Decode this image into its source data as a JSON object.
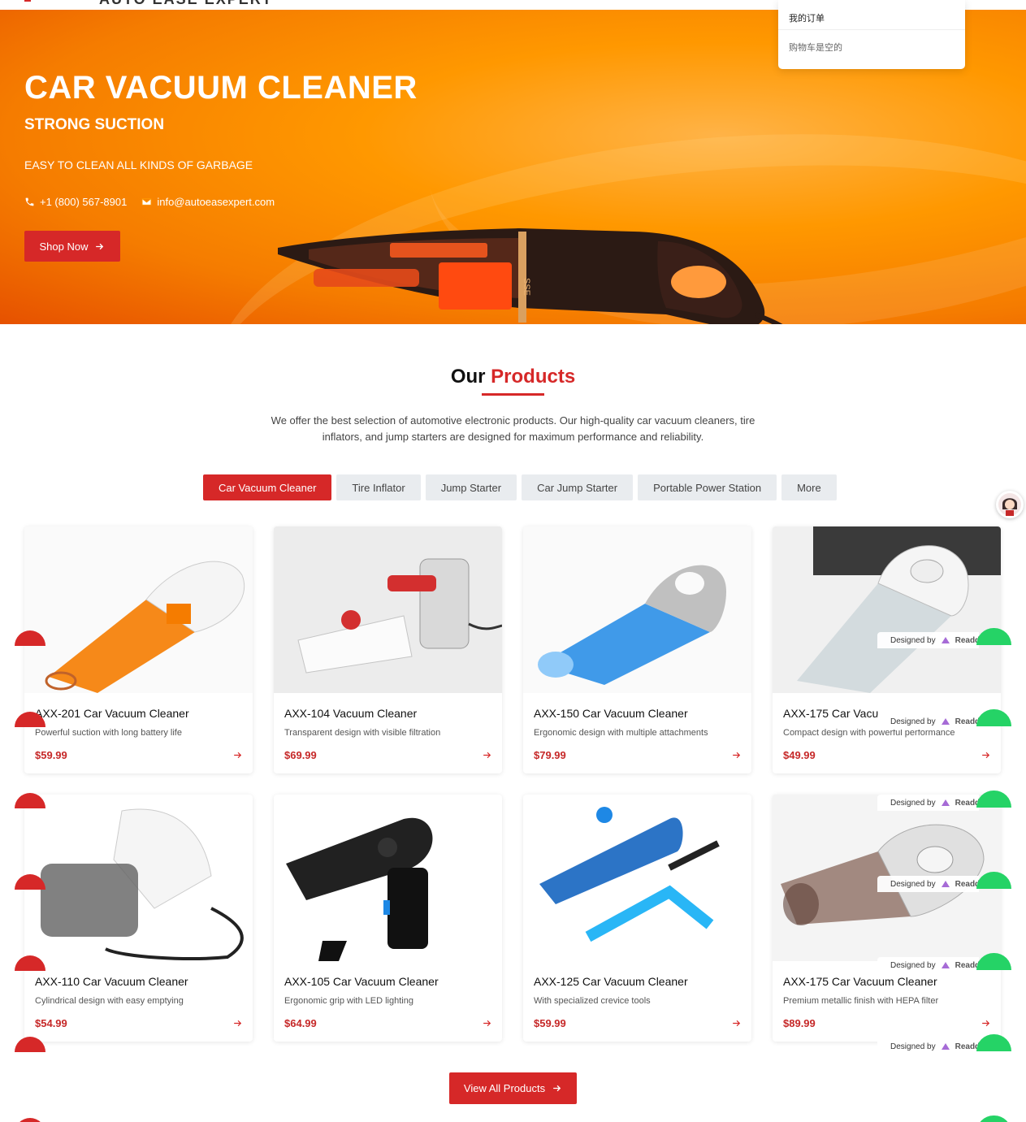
{
  "header": {
    "logo_text": "AUTO EASE EXPERT"
  },
  "cart": {
    "title": "我的订单",
    "empty_text": "购物车是空的"
  },
  "hero": {
    "title": "CAR VACUUM CLEANER",
    "subtitle": "STRONG SUCTION",
    "description": "EASY TO CLEAN ALL KINDS OF GARBAGE",
    "phone": "+1 (800) 567-8901",
    "email": "info@autoeasexpert.com",
    "cta_label": "Shop Now",
    "product_label": "SSE"
  },
  "products_section": {
    "title_part1": "Our",
    "title_part2": "Products",
    "description": "We offer the best selection of automotive electronic products. Our high-quality car vacuum cleaners, tire inflators, and jump starters are designed for maximum performance and reliability.",
    "tabs": [
      {
        "label": "Car Vacuum Cleaner",
        "active": true
      },
      {
        "label": "Tire Inflator",
        "active": false
      },
      {
        "label": "Jump Starter",
        "active": false
      },
      {
        "label": "Car Jump Starter",
        "active": false
      },
      {
        "label": "Portable Power Station",
        "active": false
      },
      {
        "label": "More",
        "active": false
      }
    ],
    "products": [
      {
        "name": "AXX-201 Car Vacuum Cleaner",
        "desc": "Powerful suction with long battery life",
        "price": "$59.99",
        "color": "#f57c00"
      },
      {
        "name": "AXX-104 Vacuum Cleaner",
        "desc": "Transparent design with visible filtration",
        "price": "$69.99",
        "color": "#d32f2f"
      },
      {
        "name": "AXX-150 Car Vacuum Cleaner",
        "desc": "Ergonomic design with multiple attachments",
        "price": "$79.99",
        "color": "#1e88e5"
      },
      {
        "name": "AXX-175 Car Vacu",
        "desc": "Compact design with powerful performance",
        "price": "$49.99",
        "color": "#bdbdbd"
      },
      {
        "name": "AXX-110 Car Vacuum Cleaner",
        "desc": "Cylindrical design with easy emptying",
        "price": "$54.99",
        "color": "#616161"
      },
      {
        "name": "AXX-105 Car Vacuum Cleaner",
        "desc": "Ergonomic grip with LED lighting",
        "price": "$64.99",
        "color": "#212121"
      },
      {
        "name": "AXX-125 Car Vacuum Cleaner",
        "desc": "With specialized crevice tools",
        "price": "$59.99",
        "color": "#1565c0"
      },
      {
        "name": "AXX-175 Car Vacuum Cleaner",
        "desc": "Premium metallic finish with HEPA filter",
        "price": "$89.99",
        "color": "#8d6e63"
      }
    ],
    "view_all_label": "View All Products"
  },
  "overlay": {
    "designed_by": "Designed by",
    "designed_brand": "Readd"
  },
  "icons": {
    "phone": "phone-icon",
    "email": "envelope-icon",
    "arrow": "arrow-right-icon",
    "whatsapp": "whatsapp-icon",
    "chat_avatar": "avatar-icon"
  },
  "colors": {
    "accent": "#d62828",
    "hero_orange": "#ff9800",
    "whatsapp_green": "#25d366"
  }
}
